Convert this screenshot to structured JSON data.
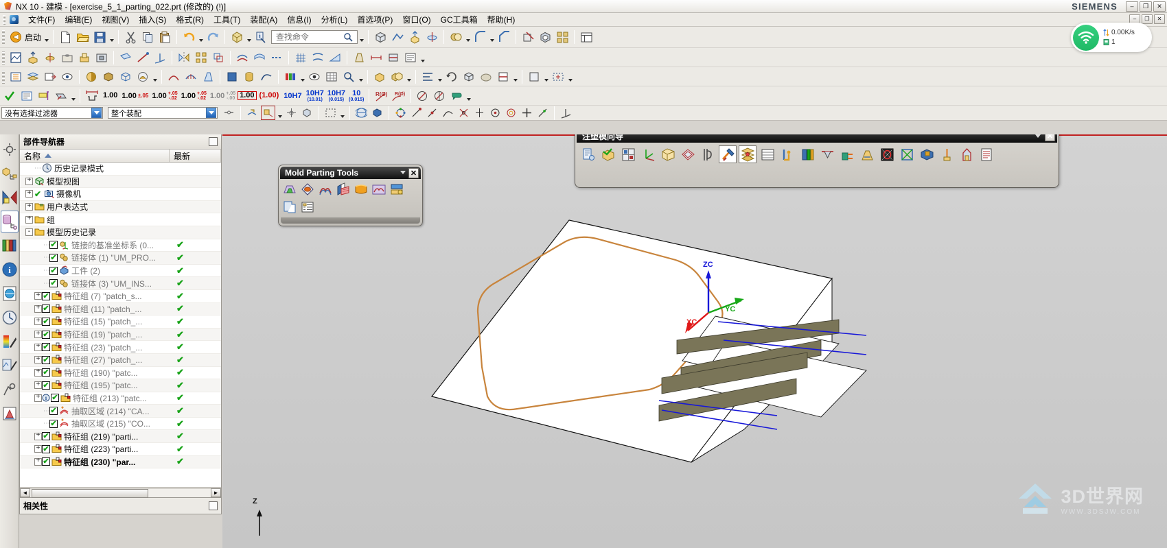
{
  "window": {
    "title": "NX 10 - 建模 - [exercise_5_1_parting_022.prt  (修改的)      (!)]",
    "brand": "SIEMENS",
    "buttons": {
      "minimize": "–",
      "maximize": "❐",
      "close": "✕"
    },
    "doc_buttons": {
      "minimize": "–",
      "restore": "❐",
      "close": "✕"
    }
  },
  "menu": {
    "items": [
      {
        "label": "文件(F)"
      },
      {
        "label": "编辑(E)"
      },
      {
        "label": "视图(V)"
      },
      {
        "label": "插入(S)"
      },
      {
        "label": "格式(R)"
      },
      {
        "label": "工具(T)"
      },
      {
        "label": "装配(A)"
      },
      {
        "label": "信息(I)"
      },
      {
        "label": "分析(L)"
      },
      {
        "label": "首选项(P)"
      },
      {
        "label": "窗口(O)"
      },
      {
        "label": "GC工具箱"
      },
      {
        "label": "帮助(H)"
      }
    ]
  },
  "standard_toolbar": {
    "start_label": "启动",
    "search_placeholder": "查找命令"
  },
  "tolerance_toolbar": {
    "values": [
      "1.00",
      "1.00",
      "1.00",
      "1.00",
      "1.00",
      "1.00",
      "(1.00)"
    ],
    "fractions": [
      {
        "top": "+.05",
        "bottom": "-.02"
      },
      {
        "top": "+.05",
        "bottom": "-.02"
      },
      {
        "top": "+.05",
        "bottom": "-.00"
      },
      {
        "top": "+.00",
        "bottom": "-.02"
      }
    ],
    "pm": "±.05",
    "fits": [
      {
        "main": "10H7",
        "sub": ""
      },
      {
        "main": "10H7",
        "sub": "(10.01)"
      },
      {
        "main": "10H7",
        "sub": "(0.015)"
      },
      {
        "main": "10",
        "sub": "(0.015)"
      }
    ],
    "radius_labels": [
      "R(Ø)",
      "R(Ø)"
    ]
  },
  "filter_bar": {
    "selection_filter": "没有选择过滤器",
    "scope_filter": "整个装配"
  },
  "part_navigator": {
    "title": "部件导航器",
    "columns": [
      "名称",
      "最新"
    ],
    "check_glyph": "✔",
    "rows": [
      {
        "indent": 1,
        "expander": "",
        "checkbox": false,
        "icon": "clock-icon",
        "label": "历史记录模式",
        "latest": "",
        "style": "dark"
      },
      {
        "indent": 0,
        "expander": "+",
        "checkbox": false,
        "icon": "model-view-icon",
        "label": "模型视图",
        "latest": "",
        "style": "dark"
      },
      {
        "indent": 0,
        "expander": "+",
        "checkbox": false,
        "icon": "camera-icon",
        "label": "摄像机",
        "latest": "",
        "style": "dark",
        "pre_check": true
      },
      {
        "indent": 0,
        "expander": "+",
        "checkbox": false,
        "icon": "folder-expr-icon",
        "label": "用户表达式",
        "latest": "",
        "style": "dark"
      },
      {
        "indent": 0,
        "expander": "+",
        "checkbox": false,
        "icon": "folder-icon",
        "label": "组",
        "latest": "",
        "style": "dark"
      },
      {
        "indent": 0,
        "expander": "-",
        "checkbox": false,
        "icon": "folder-icon",
        "label": "模型历史记录",
        "latest": "",
        "style": "dark"
      },
      {
        "indent": 2,
        "expander": "",
        "checkbox": true,
        "icon": "datum-csys-icon",
        "label": "链接的基准坐标系 (0...",
        "latest": "✔",
        "style": "gray"
      },
      {
        "indent": 2,
        "expander": "",
        "checkbox": true,
        "icon": "linked-body-icon",
        "label": "链接体 (1) \"UM_PRO...",
        "latest": "✔",
        "style": "gray"
      },
      {
        "indent": 2,
        "expander": "",
        "checkbox": true,
        "icon": "workpiece-icon",
        "label": "工件 (2)",
        "latest": "✔",
        "style": "gray"
      },
      {
        "indent": 2,
        "expander": "",
        "checkbox": true,
        "icon": "linked-body-icon",
        "label": "链接体 (3) \"UM_INS...",
        "latest": "✔",
        "style": "gray"
      },
      {
        "indent": 1,
        "expander": "+",
        "checkbox": true,
        "icon": "feature-set-icon",
        "label": "特征组 (7) \"patch_s...",
        "latest": "✔",
        "style": "gray"
      },
      {
        "indent": 1,
        "expander": "+",
        "checkbox": true,
        "icon": "feature-set-icon",
        "label": "特征组 (11) \"patch_...",
        "latest": "✔",
        "style": "gray"
      },
      {
        "indent": 1,
        "expander": "+",
        "checkbox": true,
        "icon": "feature-set-icon",
        "label": "特征组 (15) \"patch_...",
        "latest": "✔",
        "style": "gray"
      },
      {
        "indent": 1,
        "expander": "+",
        "checkbox": true,
        "icon": "feature-set-icon",
        "label": "特征组 (19) \"patch_...",
        "latest": "✔",
        "style": "gray"
      },
      {
        "indent": 1,
        "expander": "+",
        "checkbox": true,
        "icon": "feature-set-icon",
        "label": "特征组 (23) \"patch_...",
        "latest": "✔",
        "style": "gray"
      },
      {
        "indent": 1,
        "expander": "+",
        "checkbox": true,
        "icon": "feature-set-icon",
        "label": "特征组 (27) \"patch_...",
        "latest": "✔",
        "style": "gray"
      },
      {
        "indent": 1,
        "expander": "+",
        "checkbox": true,
        "icon": "feature-set-icon",
        "label": "特征组 (190) \"patc...",
        "latest": "✔",
        "style": "gray"
      },
      {
        "indent": 1,
        "expander": "+",
        "checkbox": true,
        "icon": "feature-set-icon",
        "label": "特征组 (195) \"patc...",
        "latest": "✔",
        "style": "gray"
      },
      {
        "indent": 1,
        "expander": "+",
        "checkbox": true,
        "icon": "feature-set-icon",
        "label": "特征组 (213) \"patc...",
        "latest": "✔",
        "style": "gray",
        "info": true
      },
      {
        "indent": 2,
        "expander": "",
        "checkbox": true,
        "icon": "extract-region-icon",
        "label": "抽取区域 (214) \"CA...",
        "latest": "✔",
        "style": "gray"
      },
      {
        "indent": 2,
        "expander": "",
        "checkbox": true,
        "icon": "extract-region-icon",
        "label": "抽取区域 (215) \"CO...",
        "latest": "✔",
        "style": "gray"
      },
      {
        "indent": 1,
        "expander": "+",
        "checkbox": true,
        "icon": "feature-set-icon",
        "label": "特征组 (219) \"parti...",
        "latest": "✔",
        "style": "dark"
      },
      {
        "indent": 1,
        "expander": "+",
        "checkbox": true,
        "icon": "feature-set-icon",
        "label": "特征组 (223) \"parti...",
        "latest": "✔",
        "style": "dark"
      },
      {
        "indent": 1,
        "expander": "+",
        "checkbox": true,
        "icon": "feature-set-icon",
        "label": "特征组 (230) \"par...",
        "latest": "✔",
        "style": "bold"
      }
    ],
    "bottom_panel_title": "相关性"
  },
  "mold_parting_tools": {
    "title": "Mold Parting Tools",
    "close_label": "✕",
    "buttons": [
      {
        "name": "design-parting-solid-icon"
      },
      {
        "name": "check-region-icon"
      },
      {
        "name": "define-region-icon"
      },
      {
        "name": "design-parting-surface-icon"
      },
      {
        "name": "surface-patch-icon"
      },
      {
        "name": "edit-parting-surface-icon"
      },
      {
        "name": "define-cavity-core-icon"
      },
      {
        "name": "exchange-model-icon"
      },
      {
        "name": "parting-navigator-icon"
      }
    ]
  },
  "mold_wizard": {
    "title": "注塑模向导",
    "close_label": "✕",
    "buttons": [
      {
        "name": "initialize-project-icon"
      },
      {
        "name": "multi-cavity-layout-icon"
      },
      {
        "name": "mold-csys-icon"
      },
      {
        "name": "set-wcs-icon"
      },
      {
        "name": "workpiece-icon"
      },
      {
        "name": "cavity-layout-icon"
      },
      {
        "name": "mold-tools-icon"
      },
      {
        "name": "parting-tools-icon",
        "selected": true
      },
      {
        "name": "mold-base-library-icon",
        "selected": true
      },
      {
        "name": "standard-part-library-icon"
      },
      {
        "name": "slider-lifter-icon"
      },
      {
        "name": "sub-insert-library-icon"
      },
      {
        "name": "gate-library-icon"
      },
      {
        "name": "runner-icon"
      },
      {
        "name": "cooling-tools-icon"
      },
      {
        "name": "electrode-icon"
      },
      {
        "name": "mold-trim-icon"
      },
      {
        "name": "pocket-icon"
      },
      {
        "name": "concept-design-icon"
      },
      {
        "name": "view-manager-icon"
      },
      {
        "name": "bill-of-material-icon"
      },
      {
        "name": "drawing-icon"
      },
      {
        "name": "unite-icon"
      },
      {
        "name": "mold-part-validation-icon"
      }
    ]
  },
  "graphics": {
    "csys": {
      "x_label": "XC",
      "y_label": "YC",
      "z_label": "ZC"
    },
    "corner_axis": "Z",
    "colors": {
      "background_top": "#d3d3d3",
      "background_bottom": "#c6c6c6",
      "parting_edge": "#c88a4a",
      "solid_face": "#ffffff",
      "rib_side": "#7a7558",
      "blue_edge": "#1818d8",
      "x_axis": "#e01818",
      "y_axis": "#18a818",
      "z_axis": "#1818d8"
    }
  },
  "watermark": {
    "text": "3D世界网",
    "sub": "WWW.3DSJW.COM"
  },
  "network_widget": {
    "speed": "0.00K/s",
    "count": "1"
  }
}
